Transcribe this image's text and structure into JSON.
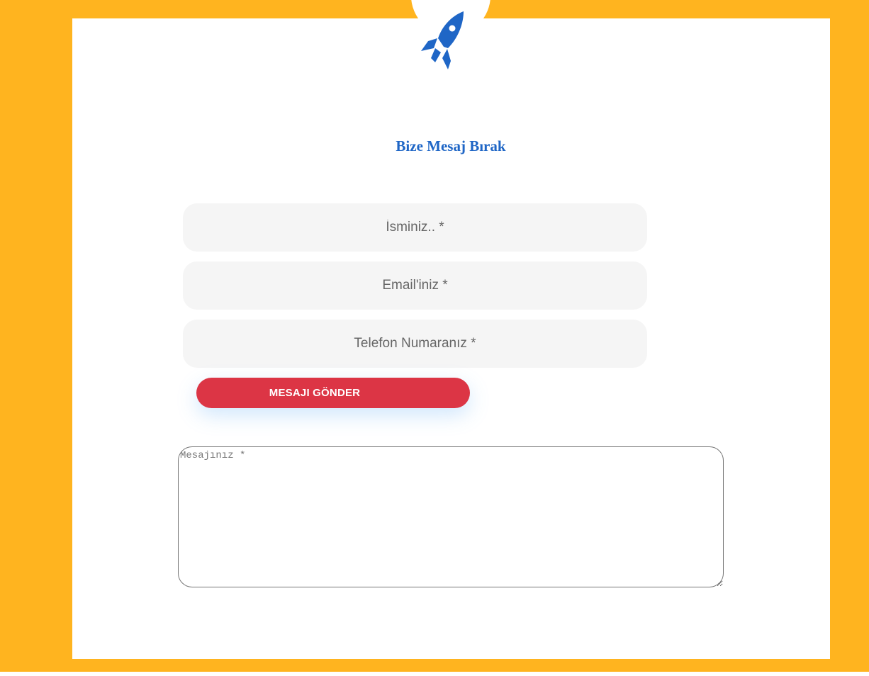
{
  "form": {
    "title": "Bize Mesaj Bırak",
    "fields": {
      "name_placeholder": "İsminiz.. *",
      "email_placeholder": "Email'iniz *",
      "phone_placeholder": "Telefon Numaranız *",
      "message_placeholder": "Mesajınız *"
    },
    "submit_label": "MESAJI GÖNDER"
  },
  "icons": {
    "logo": "rocket-icon"
  },
  "colors": {
    "background": "#ffb41f",
    "card": "#ffffff",
    "title": "#1f66c6",
    "rocket": "#1f66c6",
    "input_background": "#f5f5f5",
    "submit_button": "#dc3545"
  }
}
